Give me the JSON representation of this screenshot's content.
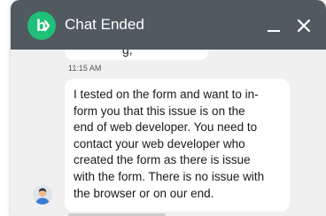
{
  "header": {
    "title": "Chat Ended",
    "logo_letter": "b",
    "logo_color": "#1fc078",
    "background_color": "#505a60",
    "minimize_icon": "minimize-icon",
    "close_icon": "close-icon"
  },
  "conversation": {
    "previous_message_fragment": "g,",
    "previous_timestamp": "11:15 AM",
    "message": {
      "lines": [
        "I tested on the form and want to in-",
        "form you that this issue is on the",
        "end of web developer. You need to",
        "contact your web developer who",
        "created the form as there is issue",
        "with the form. There is no issue with",
        "the browser or on our end."
      ]
    },
    "agent_avatar_icon": "agent-avatar-icon"
  }
}
